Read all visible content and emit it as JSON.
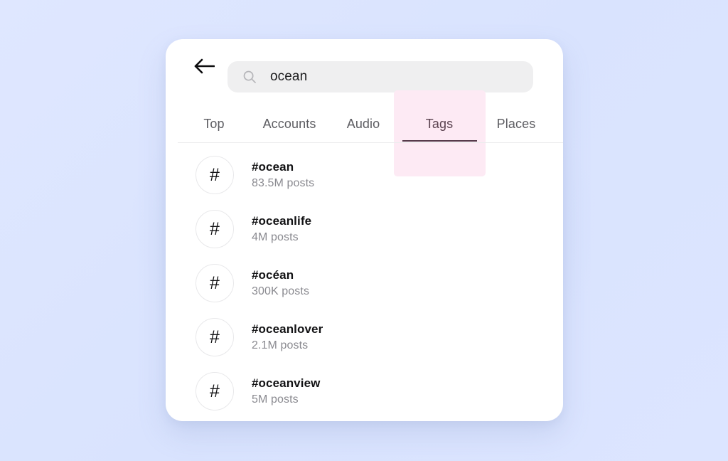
{
  "background": {
    "color": "#dde6ff"
  },
  "card": {
    "background": "#ffffff"
  },
  "search": {
    "back_icon": "arrow-left-icon",
    "search_icon": "search-icon",
    "value": "ocean",
    "placeholder": "Search"
  },
  "tabs": {
    "items": [
      {
        "label": "Top",
        "active": false
      },
      {
        "label": "Accounts",
        "active": false
      },
      {
        "label": "Audio",
        "active": false
      },
      {
        "label": "Tags",
        "active": true
      },
      {
        "label": "Places",
        "active": false
      }
    ],
    "active_index": 3,
    "highlight_color": "#fdeaf4",
    "underline_color": "#553a4a",
    "active_label_color": "#5b4350",
    "inactive_label_color": "#5d5d62"
  },
  "results": {
    "icon": "hash-icon",
    "items": [
      {
        "tag": "#ocean",
        "count": "83.5M posts"
      },
      {
        "tag": "#oceanlife",
        "count": "4M posts"
      },
      {
        "tag": "#océan",
        "count": "300K posts"
      },
      {
        "tag": "#oceanlover",
        "count": "2.1M posts"
      },
      {
        "tag": "#oceanview",
        "count": "5M posts"
      }
    ]
  }
}
